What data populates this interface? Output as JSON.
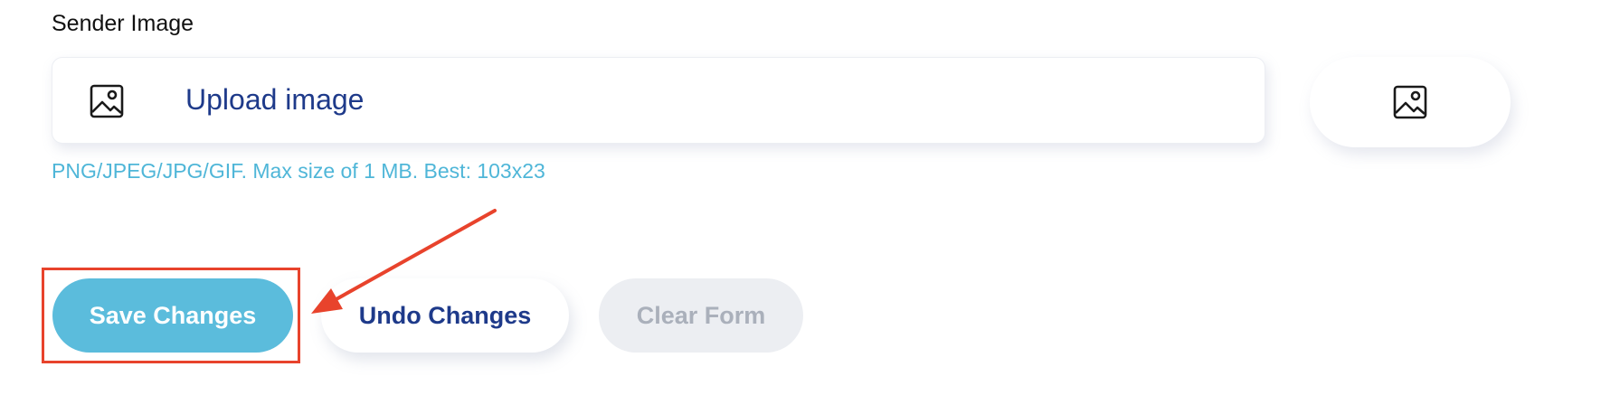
{
  "sender_image": {
    "label": "Sender Image",
    "upload_label": "Upload image",
    "hint": "PNG/JPEG/JPG/GIF. Max size of 1 MB. Best: 103x23",
    "upload_icon": "image-icon",
    "preview_icon": "image-icon"
  },
  "actions": {
    "save_label": "Save Changes",
    "undo_label": "Undo Changes",
    "clear_label": "Clear Form"
  },
  "annotation": {
    "color": "#e8432c",
    "highlighted_element": "save-button"
  },
  "colors": {
    "primary": "#5bbcdc",
    "link": "#1e3a8a",
    "hint": "#4fb6d8",
    "disabled_bg": "#eceef2",
    "disabled_text": "#aab0bb"
  }
}
